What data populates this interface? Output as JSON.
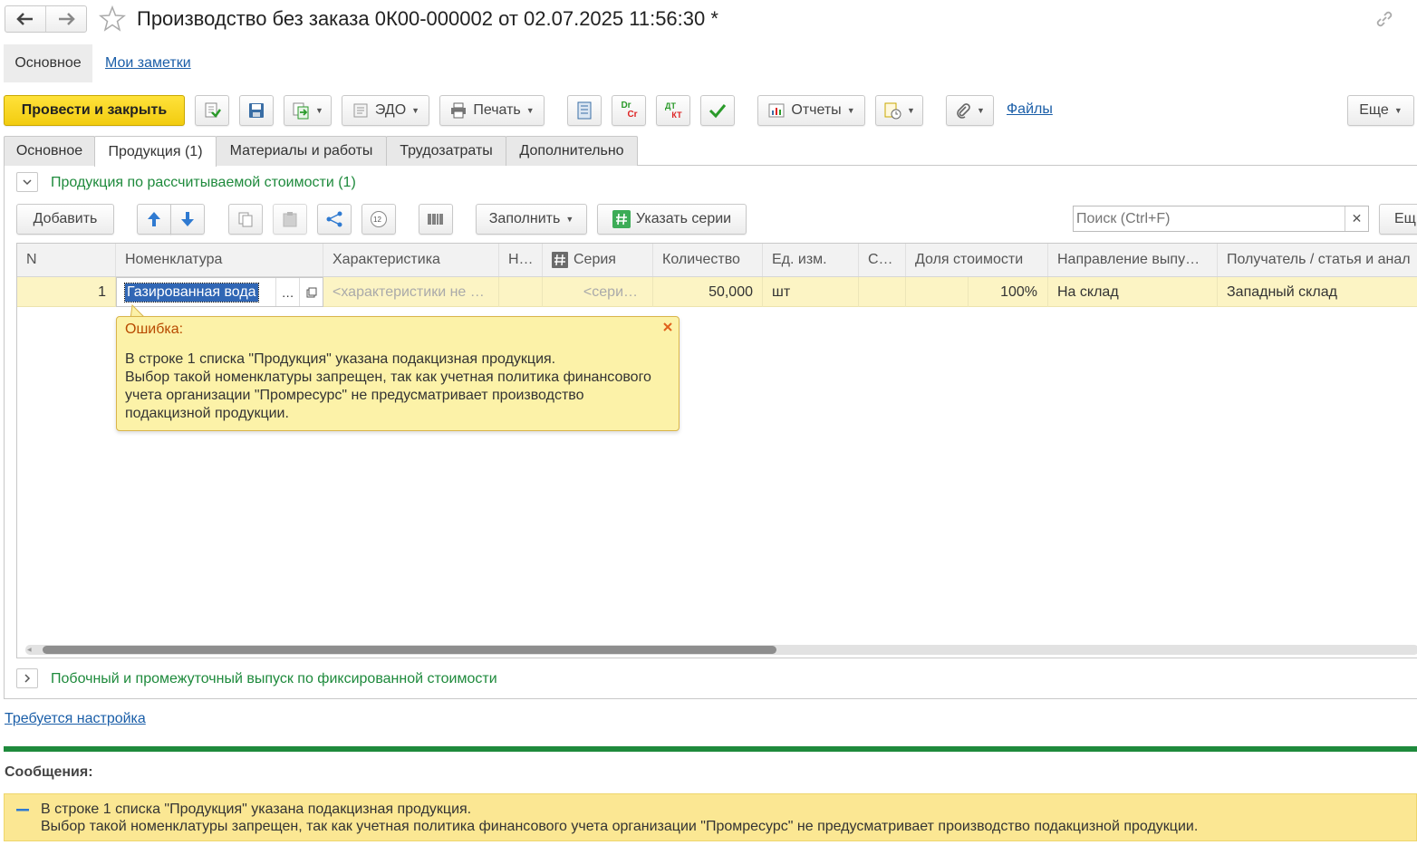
{
  "window": {
    "title": "Производство без заказа 0К00-000002 от 02.07.2025 11:56:30 *"
  },
  "nav": {
    "main_label": "Основное",
    "notes_label": "Мои заметки"
  },
  "toolbar": {
    "post_close": "Провести и закрыть",
    "edo": "ЭДО",
    "print": "Печать",
    "dr_top": "Dr",
    "dr_bottom": "Cr",
    "dt_top": "ДТ",
    "dt_bottom": "КТ",
    "reports": "Отчеты",
    "files": "Файлы",
    "more": "Еще"
  },
  "tabs": [
    {
      "label": "Основное"
    },
    {
      "label": "Продукция (1)"
    },
    {
      "label": "Материалы и работы"
    },
    {
      "label": "Трудозатраты"
    },
    {
      "label": "Дополнительно"
    }
  ],
  "section1": {
    "title": "Продукция по рассчитываемой стоимости (1)"
  },
  "table_toolbar": {
    "add": "Добавить",
    "fill": "Заполнить",
    "series": "Указать серии",
    "search_placeholder": "Поиск (Ctrl+F)",
    "more": "Ещ",
    "numbers_icon": "12"
  },
  "table": {
    "columns": [
      "N",
      "Номенклатура",
      "Характеристика",
      "Н…",
      "Серия",
      "Количество",
      "Ед. изм.",
      "С…",
      "Доля стоимости",
      "Направление выпу…",
      "Получатель / статья и анал"
    ],
    "row": {
      "n": "1",
      "nomenclature": "Газированная вода",
      "characteristic": "<характеристики не …",
      "n2": "",
      "series": "<сери…",
      "quantity": "50,000",
      "unit": "шт",
      "c": "",
      "share": "100%",
      "direction": "На склад",
      "recipient": "Западный склад"
    }
  },
  "error_popup": {
    "title": "Ошибка:",
    "line1": "В строке 1 списка \"Продукция\" указана подакцизная продукция.",
    "line2": "Выбор такой номенклатуры запрещен, так как учетная политика финансового",
    "line3": "учета организации \"Промресурс\" не предусматривает производство",
    "line4": "подакцизной продукции."
  },
  "section2": {
    "title": "Побочный и промежуточный выпуск по фиксированной стоимости"
  },
  "setup_link": "Требуется настройка",
  "messages": {
    "header": "Сообщения:",
    "line1": "В строке 1 списка \"Продукция\" указана подакцизная продукция.",
    "line2": "Выбор такой номенклатуры запрещен, так как учетная политика финансового учета организации \"Промресурс\" не предусматривает производство подакцизной продукции."
  },
  "colors": {
    "accent_yellow": "#f5d41c",
    "green_title": "#1e8a3c",
    "link": "#1a5ea8",
    "popup_bg": "#fcf2a8",
    "message_bg": "#fbe793"
  }
}
